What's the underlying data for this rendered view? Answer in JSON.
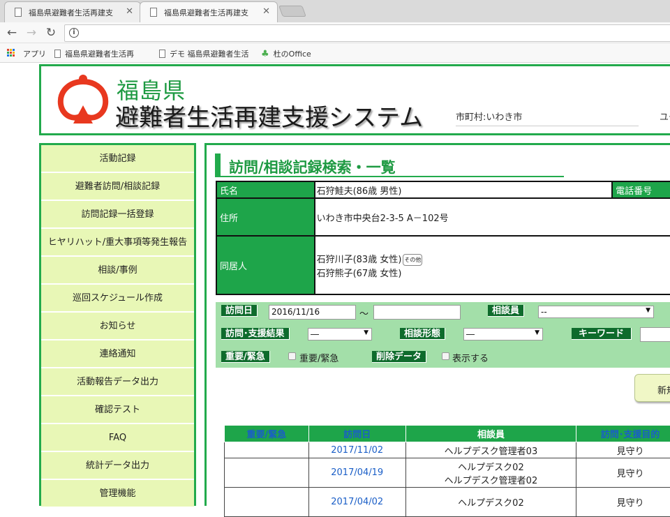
{
  "browser": {
    "tabs": [
      {
        "title": "福島県避難者生活再建支"
      },
      {
        "title": "福島県避難者生活再建支"
      }
    ],
    "bookmarks": [
      {
        "label": "アプリ"
      },
      {
        "label": "福島県避難者生活再"
      },
      {
        "label": "デモ 福島県避難者生活"
      },
      {
        "label": "杜のOffice"
      }
    ]
  },
  "header": {
    "prefecture": "福島県",
    "system_name": "避難者生活再建支援システム",
    "municipality": "市町村:いわき市",
    "user_label": "ユー"
  },
  "sidebar": {
    "items": [
      {
        "label": "活動記録"
      },
      {
        "label": "避難者訪問/相談記録"
      },
      {
        "label": "訪問記録一括登録"
      },
      {
        "label": "ヒヤリハット/重大事項等発生報告"
      },
      {
        "label": "相談/事例"
      },
      {
        "label": "巡回スケジュール作成"
      },
      {
        "label": "お知らせ"
      },
      {
        "label": "連絡通知"
      },
      {
        "label": "活動報告データ出力"
      },
      {
        "label": "確認テスト"
      },
      {
        "label": "FAQ"
      },
      {
        "label": "統計データ出力"
      },
      {
        "label": "管理機能"
      }
    ]
  },
  "main": {
    "title": "訪問/相談記録検索・一覧",
    "person": {
      "name_label": "氏名",
      "name": "石狩鮭夫(86歳 男性)",
      "phone_label": "電話番号",
      "address_label": "住所",
      "address": "いわき市中央台2-3-5 A－102号",
      "cohabitant_label": "同居人",
      "cohabitants": [
        "石狩川子(83歳 女性)",
        "石狩熊子(67歳 女性)"
      ],
      "other_tag": "その他"
    },
    "search": {
      "visit_date_label": "訪問日",
      "visit_date_from": "2016/11/16",
      "tilde": "～",
      "visit_date_to": "",
      "counselor_label": "相談員",
      "counselor_value": "--",
      "result_label": "訪問･支援結果",
      "result_value": "―",
      "form_label": "相談形態",
      "form_value": "―",
      "keyword_label": "キーワード",
      "keyword_value": "",
      "urgent_label": "重要/緊急",
      "urgent_checkbox": "重要/緊急",
      "deleted_label": "削除データ",
      "deleted_checkbox": "表示する"
    },
    "new_button": "新規",
    "table": {
      "headers": [
        "重要/緊急",
        "訪問日",
        "相談員",
        "訪問･支援目的"
      ],
      "rows": [
        {
          "urgent": "",
          "date": "2017/11/02",
          "counselors": [
            "ヘルプデスク管理者03"
          ],
          "purpose": "見守り"
        },
        {
          "urgent": "",
          "date": "2017/04/19",
          "counselors": [
            "ヘルプデスク02",
            "ヘルプデスク管理者02"
          ],
          "purpose": "見守り"
        },
        {
          "urgent": "",
          "date": "2017/04/02",
          "counselors": [
            "ヘルプデスク02"
          ],
          "purpose": "見守り"
        }
      ]
    }
  },
  "colors": {
    "brand_green": "#22aa4c",
    "label_green": "#1ea54a",
    "dark_green": "#0e6b2c",
    "search_bg": "#a3dfa9",
    "sidebar_bg": "#e8f7b6",
    "link_blue": "#1a5ec7",
    "logo_red": "#e8381f"
  }
}
